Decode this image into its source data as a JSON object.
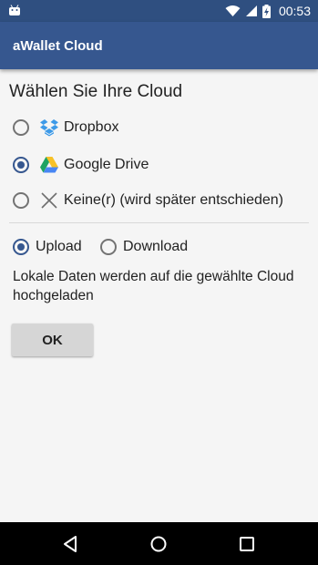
{
  "status_bar": {
    "time": "00:53",
    "icons": [
      "android-icon",
      "wifi-icon",
      "signal-icon",
      "battery-charging-icon"
    ]
  },
  "app_bar": {
    "title": "aWallet Cloud",
    "color": "#36578f"
  },
  "cloud_select": {
    "heading": "Wählen Sie Ihre Cloud",
    "options": [
      {
        "label": "Dropbox",
        "icon": "dropbox-icon",
        "selected": false
      },
      {
        "label": "Google Drive",
        "icon": "google-drive-icon",
        "selected": true
      },
      {
        "label": "Keine(r) (wird später entschieden)",
        "icon": "close-x-icon",
        "selected": false
      }
    ]
  },
  "direction": {
    "options": [
      {
        "label": "Upload",
        "selected": true
      },
      {
        "label": "Download",
        "selected": false
      }
    ],
    "description": "Lokale Daten werden auf die gewählte Cloud hochgeladen"
  },
  "ok_button": {
    "label": "OK"
  },
  "nav_bar": {
    "buttons": [
      "back-icon",
      "home-icon",
      "recents-icon"
    ]
  }
}
